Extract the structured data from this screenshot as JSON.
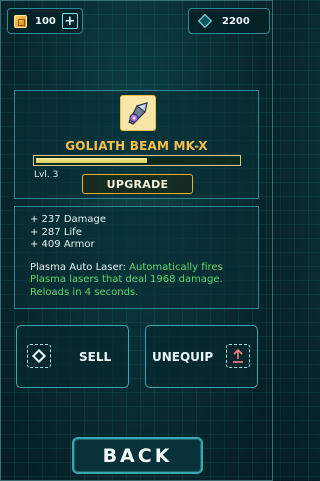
{
  "topbar": {
    "coins": {
      "icon": "coin-icon",
      "value": "100",
      "add_icon": "plus-icon"
    },
    "gems": {
      "icon": "gem-icon",
      "value": "2200"
    }
  },
  "item": {
    "icon": "laser-gun-icon",
    "name": "GOLIATH BEAM MK-X",
    "level": "Lvl. 3",
    "xp_progress": 0.55,
    "upgrade_label": "UPGRADE"
  },
  "stats": {
    "lines": [
      "+ 237 Damage",
      "+ 287 Life",
      "+ 409 Armor"
    ],
    "ability_name": "Plasma Auto Laser:",
    "ability_desc": "Automatically fires Plasma lasers that deal 1968 damage. Reloads in 4 seconds."
  },
  "actions": {
    "sell_label": "SELL",
    "sell_icon": "diamond-icon",
    "unequip_label": "UNEQUIP",
    "unequip_icon": "unequip-arrow-icon"
  },
  "back_label": "BACK",
  "colors": {
    "accent": "#2f8891",
    "gold": "#f4c04a",
    "ability_green": "#5ed86a",
    "background": "#08292e"
  }
}
